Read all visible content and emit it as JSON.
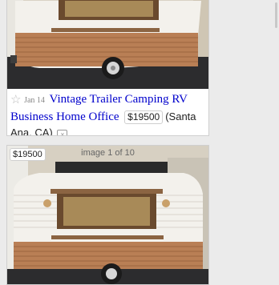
{
  "listing": {
    "date": "Jan 14",
    "title": "Vintage Trailer Camping RV Business Home Office",
    "price": "$19500",
    "location": "(Santa Ana, CA)",
    "favorite_icon": "star-icon",
    "hide_icon": "hide-listing-icon"
  },
  "gallery": {
    "price": "$19500",
    "counter": "image 1 of 10"
  },
  "colors": {
    "link": "#0000cc",
    "trailer_white": "#f3f1ec",
    "trailer_copper": "#b97f55",
    "window_wood": "#6a4a2e"
  }
}
